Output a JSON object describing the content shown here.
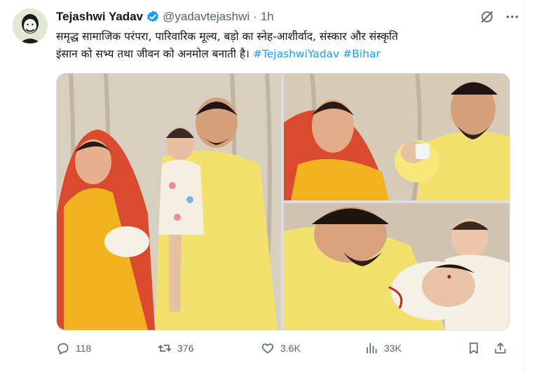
{
  "author": {
    "name": "Tejashwi Yadav",
    "handle": "@yadavtejashwi",
    "separator": "·",
    "time": "1h"
  },
  "tweet": {
    "line1": "समृद्ध सामाजिक परंपरा, पारिवारिक मूल्य, बड़ो का स्नेह-आशीर्वाद, संस्कार और संस्कृति",
    "line2_text": "इंसान को सभ्य तथा जीवन को अनमोल बनाती है। ",
    "hashtag1": "#TejashwiYadav",
    "hashtag2": "#Bihar"
  },
  "stats": {
    "replies": "118",
    "reposts": "376",
    "likes": "3.6K",
    "views": "33K"
  },
  "icons": {
    "verified": "verified-badge-icon",
    "grok": "grok-icon",
    "more": "more-icon",
    "reply": "reply-icon",
    "repost": "repost-icon",
    "like": "heart-icon",
    "views": "views-chart-icon",
    "bookmark": "bookmark-icon",
    "share": "share-icon"
  },
  "colors": {
    "link": "#1d9bf0",
    "muted": "#536471",
    "verified": "#1d9bf0"
  }
}
